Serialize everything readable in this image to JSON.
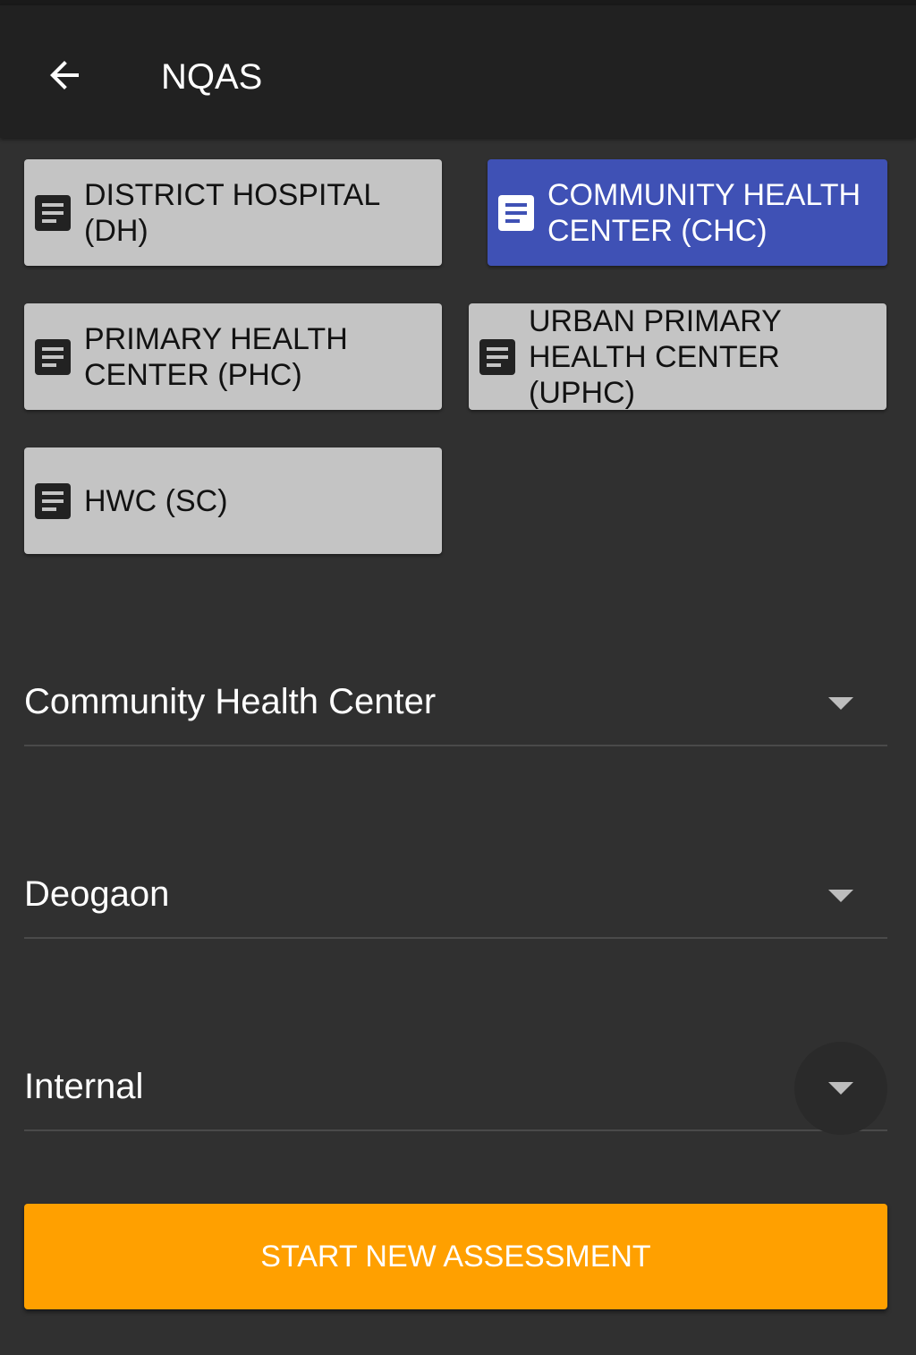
{
  "appbar": {
    "title": "NQAS",
    "back_icon": "arrow-left-icon"
  },
  "facility_types": [
    {
      "label": "DISTRICT HOSPITAL (DH)",
      "icon": "document-icon",
      "selected": false
    },
    {
      "label": "COMMUNITY HEALTH CENTER (CHC)",
      "icon": "document-icon",
      "selected": true
    },
    {
      "label": "PRIMARY HEALTH CENTER (PHC)",
      "icon": "document-icon",
      "selected": false
    },
    {
      "label": "URBAN PRIMARY HEALTH CENTER (UPHC)",
      "icon": "document-icon",
      "selected": false
    },
    {
      "label": "HWC (SC)",
      "icon": "document-icon",
      "selected": false
    }
  ],
  "selects": {
    "facility_type": {
      "value": "Community Health Center"
    },
    "facility_name": {
      "value": "Deogaon"
    },
    "assessment_type": {
      "value": "Internal"
    }
  },
  "actions": {
    "start_label": "START NEW ASSESSMENT"
  },
  "colors": {
    "appbar": "#212121",
    "background": "#303030",
    "button_default": "#c4c4c4",
    "button_selected": "#3f51b5",
    "primary_action": "#ffa000"
  }
}
